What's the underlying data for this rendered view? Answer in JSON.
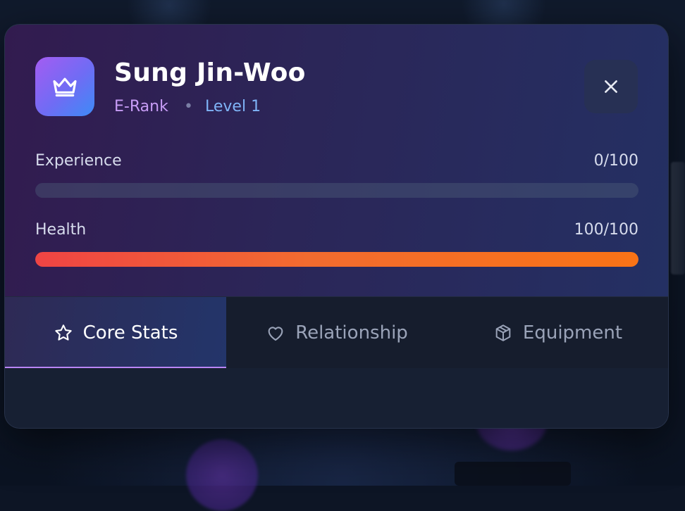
{
  "character": {
    "name": "Sung Jin-Woo",
    "rank": "E-Rank",
    "separator": "•",
    "level": "Level 1",
    "avatar_icon": "crown-icon"
  },
  "stats": {
    "experience": {
      "label": "Experience",
      "value_text": "0/100",
      "current": 0,
      "max": 100
    },
    "health": {
      "label": "Health",
      "value_text": "100/100",
      "current": 100,
      "max": 100
    }
  },
  "tabs": [
    {
      "label": "Core Stats",
      "icon": "star-icon",
      "active": true
    },
    {
      "label": "Relationship",
      "icon": "heart-icon",
      "active": false
    },
    {
      "label": "Equipment",
      "icon": "box-icon",
      "active": false
    }
  ],
  "colors": {
    "accent": "#b985f5",
    "rank": "#c79cf6",
    "level": "#7fb4f7",
    "health_start": "#ef4444",
    "health_end": "#f97316"
  }
}
